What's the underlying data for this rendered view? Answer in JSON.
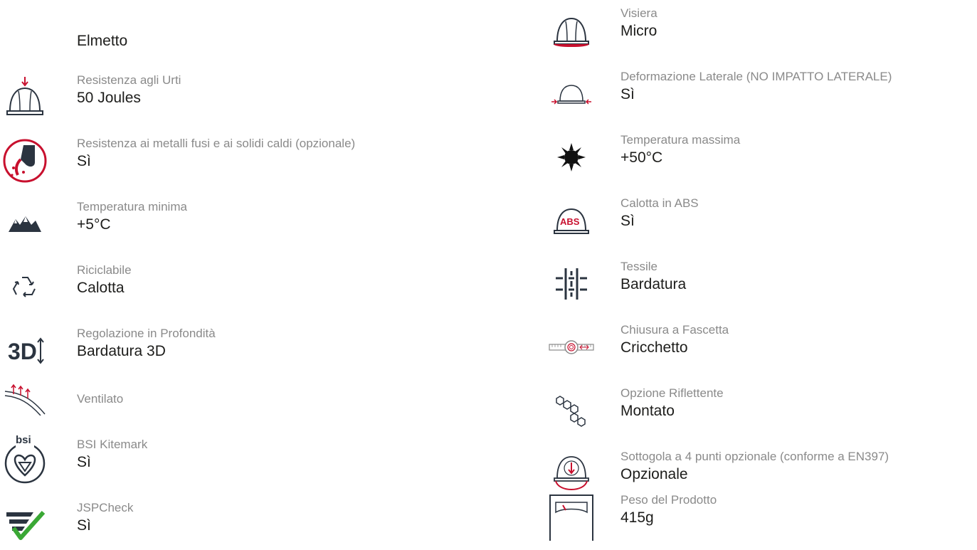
{
  "left": {
    "heading": "Elmetto",
    "items": [
      {
        "icon": "impact-helmet-icon",
        "label": "Resistenza agli Urti",
        "value": "50 Joules"
      },
      {
        "icon": "molten-metal-icon",
        "label": "Resistenza ai metalli fusi e ai solidi caldi (opzionale)",
        "value": "Sì"
      },
      {
        "icon": "mountains-icon",
        "label": "Temperatura minima",
        "value": "+5°C"
      },
      {
        "icon": "recycle-icon",
        "label": "Riciclabile",
        "value": "Calotta"
      },
      {
        "icon": "3d-adjust-icon",
        "label": "Regolazione in Profondità",
        "value": "Bardatura 3D"
      },
      {
        "icon": "ventilation-icon",
        "label": "Ventilato",
        "value": ""
      },
      {
        "icon": "bsi-kitemark-icon",
        "label": "BSI Kitemark",
        "value": "Sì"
      },
      {
        "icon": "jspcheck-icon",
        "label": "JSPCheck",
        "value": "Sì"
      }
    ]
  },
  "right": {
    "items": [
      {
        "icon": "visor-helmet-icon",
        "label": "Visiera",
        "value": "Micro"
      },
      {
        "icon": "lateral-deformation-icon",
        "label": "Deformazione Laterale (NO IMPATTO LATERALE)",
        "value": "Sì"
      },
      {
        "icon": "sun-icon",
        "label": "Temperatura massima",
        "value": "+50°C"
      },
      {
        "icon": "abs-shell-icon",
        "label": "Calotta in ABS",
        "value": "Sì",
        "badge": "ABS"
      },
      {
        "icon": "textile-icon",
        "label": "Tessile",
        "value": "Bardatura"
      },
      {
        "icon": "strap-closure-icon",
        "label": "Chiusura a Fascetta",
        "value": "Cricchetto"
      },
      {
        "icon": "reflective-icon",
        "label": "Opzione Riflettente",
        "value": "Montato"
      },
      {
        "icon": "chinstrap-icon",
        "label": "Sottogola a 4 punti opzionale (conforme a EN397)",
        "value": "Opzionale"
      },
      {
        "icon": "scale-icon",
        "label": "Peso del Prodotto",
        "value": "415g"
      }
    ]
  },
  "bsi_logo_text": "bsi",
  "colors": {
    "accent_red": "#c8102e",
    "dark": "#2b3440",
    "green": "#3aa835",
    "label_grey": "#8a8a8a"
  }
}
